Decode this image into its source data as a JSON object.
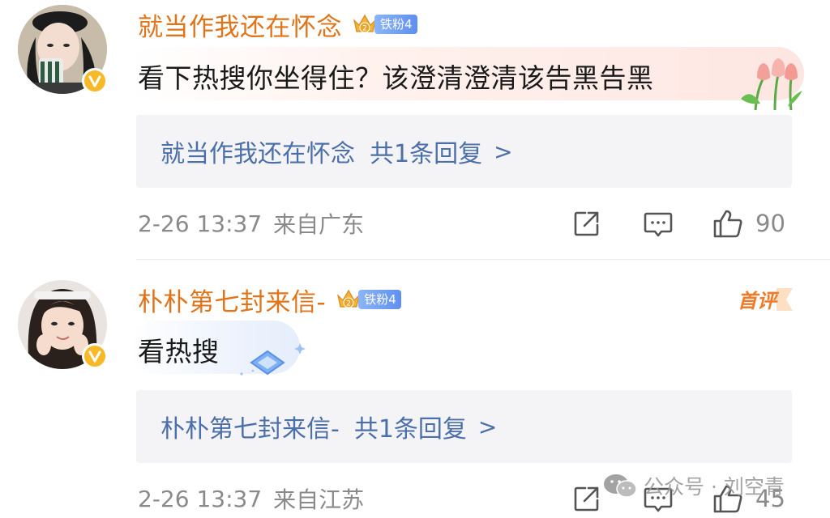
{
  "comments": [
    {
      "username": "就当作我还在怀念",
      "fan_level": "铁粉4",
      "text": "看下热搜你坐得住？该澄清澄清该告黑告黑",
      "reply_name": "就当作我还在怀念",
      "reply_count": "共1条回复",
      "reply_chevron": ">",
      "date": "2-26 13:37",
      "location": "来自广东",
      "likes": "90"
    },
    {
      "username": "朴朴第七封来信-",
      "fan_level": "铁粉4",
      "first_comment_badge": "首评",
      "text": "看热搜",
      "reply_name": "朴朴第七封来信-",
      "reply_count": "共1条回复",
      "reply_chevron": ">",
      "date": "2-26 13:37",
      "location": "来自江苏",
      "likes": "45"
    }
  ],
  "watermark": {
    "text": "公众号 · 刘空青"
  },
  "icons": {
    "share": "share-icon",
    "comment": "comment-icon",
    "like": "thumbs-up-icon",
    "verified": "verified-v-icon",
    "crown": "crown-icon"
  },
  "colors": {
    "username": "#e0741a",
    "reply_link": "#4b6fa8",
    "meta_gray": "#8a8a8a",
    "reply_bg": "#f4f4f6",
    "fan_tag": "#6f9af2",
    "verified_badge": "#f7b928"
  }
}
